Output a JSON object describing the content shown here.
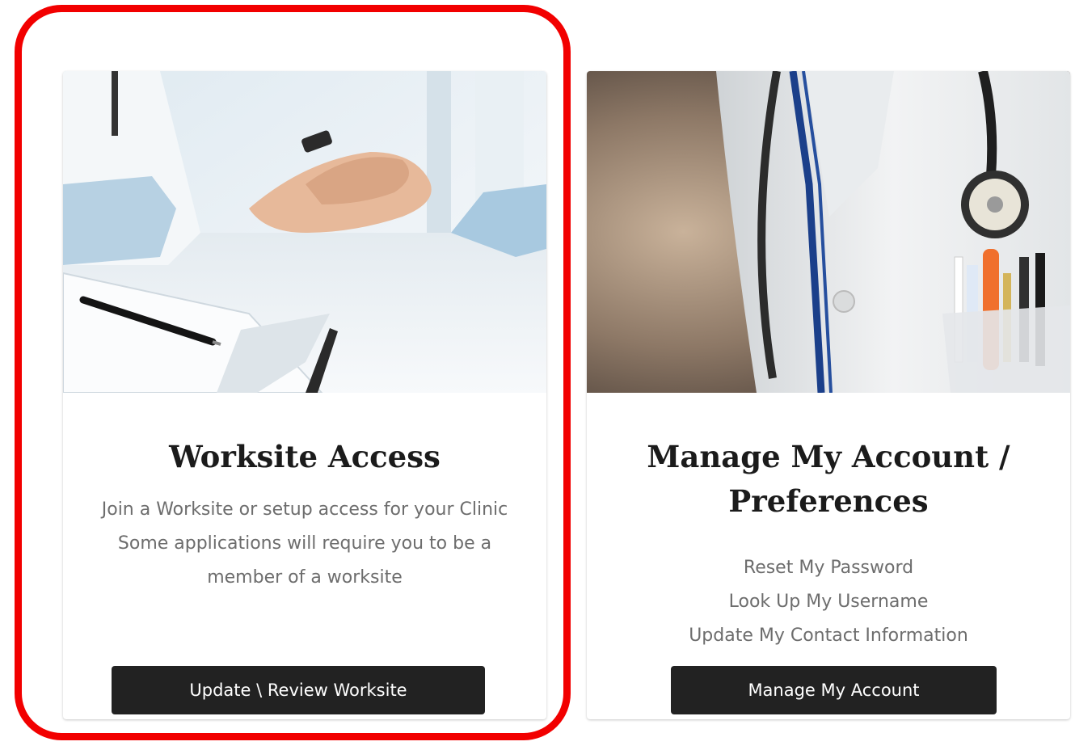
{
  "cards": [
    {
      "title": "Worksite Access",
      "description": [
        "Join a Worksite or setup access for your Clinic",
        "Some applications will require you to be a",
        "member of a worksite"
      ],
      "button_label": "Update \\ Review Worksite",
      "image": "doctor-patient-handshake-photo"
    },
    {
      "title_line1": "Manage My Account /",
      "title_line2": "Preferences",
      "links": [
        "Reset My Password",
        "Look Up My Username",
        "Update My Contact Information"
      ],
      "button_label": "Manage My Account",
      "image": "doctor-stethoscope-coat-photo"
    }
  ],
  "highlight": {
    "color": "#f20000",
    "target": "worksite-access-card"
  }
}
